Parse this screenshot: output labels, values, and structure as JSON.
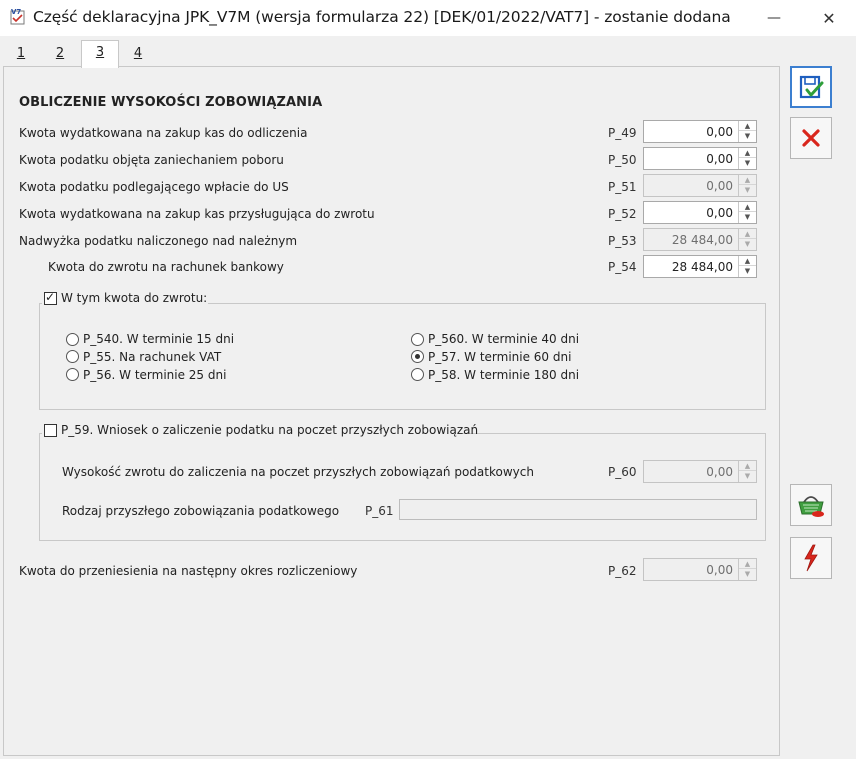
{
  "window": {
    "title": "Część deklaracyjna JPK_V7M (wersja formularza 22) [DEK/01/2022/VAT7] - zostanie dodana",
    "app_icon": "v7-form-icon",
    "minimize_glyph": "—",
    "close_glyph": "✕"
  },
  "tabs": [
    {
      "label": "1"
    },
    {
      "label": "2"
    },
    {
      "label": "3",
      "active": true
    },
    {
      "label": "4"
    }
  ],
  "section": {
    "title": "OBLICZENIE WYSOKOŚCI ZOBOWIĄZANIA"
  },
  "fields": {
    "p49": {
      "label": "Kwota wydatkowana na zakup kas do odliczenia",
      "code": "P_49",
      "value": "0,00",
      "enabled": true
    },
    "p50": {
      "label": "Kwota podatku objęta zaniechaniem poboru",
      "code": "P_50",
      "value": "0,00",
      "enabled": true
    },
    "p51": {
      "label": "Kwota podatku podlegającego wpłacie do US",
      "code": "P_51",
      "value": "0,00",
      "enabled": false
    },
    "p52": {
      "label": "Kwota wydatkowana na zakup kas przysługująca do zwrotu",
      "code": "P_52",
      "value": "0,00",
      "enabled": true
    },
    "p53": {
      "label": "Nadwyżka podatku naliczonego nad należnym",
      "code": "P_53",
      "value": "28 484,00",
      "enabled": false
    },
    "p54": {
      "label": "Kwota do zwrotu na rachunek bankowy",
      "code": "P_54",
      "value": "28 484,00",
      "enabled": true
    }
  },
  "refund_group": {
    "checkbox_label": "W tym kwota do zwrotu:",
    "checked": true,
    "options": [
      {
        "label": "P_540. W terminie 15 dni",
        "selected": false
      },
      {
        "label": "P_55. Na rachunek VAT",
        "selected": false
      },
      {
        "label": "P_56. W terminie 25 dni",
        "selected": false
      },
      {
        "label": "P_560. W terminie 40 dni",
        "selected": false
      },
      {
        "label": "P_57. W terminie 60 dni",
        "selected": true
      },
      {
        "label": "P_58. W terminie 180 dni",
        "selected": false
      }
    ]
  },
  "offset_group": {
    "checkbox_label": "P_59. Wniosek o zaliczenie podatku na poczet przyszłych zobowiązań",
    "checked": false,
    "p60": {
      "label": "Wysokość zwrotu do zaliczenia na poczet przyszłych zobowiązań podatkowych",
      "code": "P_60",
      "value": "0,00"
    },
    "p61": {
      "label": "Rodzaj przyszłego zobowiązania podatkowego",
      "code": "P_61",
      "value": ""
    }
  },
  "p62": {
    "label": "Kwota do przeniesienia na następny okres rozliczeniowy",
    "code": "P_62",
    "value": "0,00",
    "enabled": false
  },
  "side_buttons": [
    "save-icon",
    "cancel-icon",
    "basket-icon",
    "lightning-icon"
  ],
  "colors": {
    "save_blue": "#1f5fbf",
    "save_green": "#2e9e3a",
    "cancel_red": "#d9261c"
  }
}
